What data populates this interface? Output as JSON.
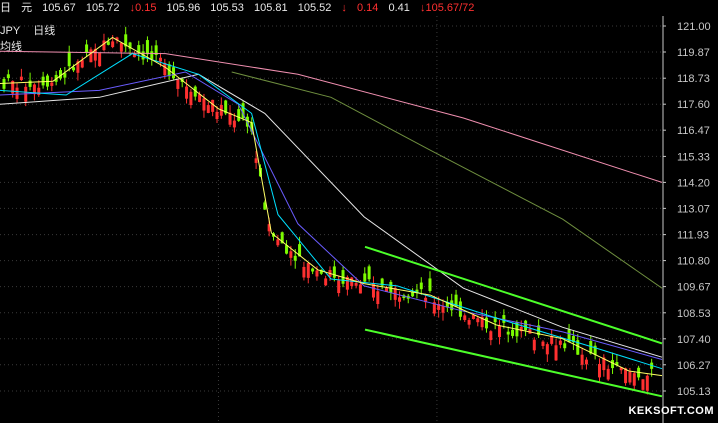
{
  "quote_bar": {
    "label_day": "日",
    "label_yuan": "元",
    "v1": "105.67",
    "v2": "105.72",
    "change": "↓0.15",
    "v3": "105.96",
    "v4": "105.53",
    "v5": "105.81",
    "v6": "105.52",
    "arrow": "↓",
    "change2": "0.14",
    "v7": "0.41",
    "bid_ask": "↓105.67/72"
  },
  "symbol": {
    "code": "JPY",
    "period": "日线",
    "indicator": "均线"
  },
  "watermark": "KEKSOFT.COM",
  "colors": {
    "background": "#000000",
    "up_candle": "#7cfc00",
    "down_candle": "#ff3030",
    "channel": "#4cff2a",
    "ma_fast": "#ffff66",
    "ma_mid": "#00e0ff",
    "ma_purple": "#6a5cff",
    "ma_white": "#e6e6e6",
    "ma_olive": "#6f8f3f",
    "ma_pink": "#f08fb0",
    "axis": "#c8c8c8"
  },
  "chart_data": {
    "type": "candlestick",
    "y_ticks": [
      "121.00",
      "119.87",
      "118.73",
      "117.60",
      "116.47",
      "115.33",
      "114.20",
      "113.07",
      "111.93",
      "110.80",
      "109.67",
      "108.53",
      "107.40",
      "106.27",
      "105.13"
    ],
    "ylim": [
      105.13,
      121.0
    ],
    "grid": true,
    "channel_upper": [
      [
        0.0,
        111.4
      ],
      [
        1.0,
        107.2
      ]
    ],
    "channel_lower": [
      [
        0.0,
        107.8
      ],
      [
        1.0,
        104.9
      ]
    ],
    "moving_averages": [
      {
        "key": "ma_pink",
        "points": [
          [
            0,
            119.9
          ],
          [
            0.25,
            119.8
          ],
          [
            0.45,
            118.9
          ],
          [
            0.7,
            117.0
          ],
          [
            1.0,
            114.2
          ]
        ]
      },
      {
        "key": "ma_olive",
        "points": [
          [
            0.35,
            119.0
          ],
          [
            0.5,
            117.9
          ],
          [
            0.65,
            115.6
          ],
          [
            0.85,
            112.6
          ],
          [
            1.0,
            109.6
          ]
        ]
      },
      {
        "key": "ma_white",
        "points": [
          [
            0.0,
            117.6
          ],
          [
            0.15,
            117.9
          ],
          [
            0.3,
            118.9
          ],
          [
            0.4,
            117.2
          ],
          [
            0.55,
            112.7
          ],
          [
            0.7,
            109.6
          ],
          [
            0.85,
            107.9
          ],
          [
            1.0,
            106.6
          ]
        ]
      },
      {
        "key": "ma_purple",
        "points": [
          [
            0.0,
            118.0
          ],
          [
            0.15,
            118.2
          ],
          [
            0.28,
            119.0
          ],
          [
            0.36,
            117.6
          ],
          [
            0.45,
            112.4
          ],
          [
            0.55,
            109.7
          ],
          [
            0.7,
            108.6
          ],
          [
            0.85,
            107.7
          ],
          [
            1.0,
            106.5
          ]
        ]
      },
      {
        "key": "ma_mid",
        "points": [
          [
            0.0,
            118.2
          ],
          [
            0.1,
            118.0
          ],
          [
            0.2,
            119.8
          ],
          [
            0.3,
            118.9
          ],
          [
            0.38,
            117.2
          ],
          [
            0.42,
            112.8
          ],
          [
            0.5,
            110.0
          ],
          [
            0.6,
            109.7
          ],
          [
            0.75,
            108.3
          ],
          [
            0.9,
            107.0
          ],
          [
            1.0,
            106.1
          ]
        ]
      },
      {
        "key": "ma_fast",
        "points": [
          [
            0.0,
            118.5
          ],
          [
            0.08,
            118.6
          ],
          [
            0.17,
            120.5
          ],
          [
            0.25,
            119.2
          ],
          [
            0.33,
            117.4
          ],
          [
            0.38,
            116.8
          ],
          [
            0.41,
            112.0
          ],
          [
            0.48,
            110.4
          ],
          [
            0.55,
            109.8
          ],
          [
            0.65,
            109.3
          ],
          [
            0.75,
            108.0
          ],
          [
            0.85,
            107.4
          ],
          [
            0.95,
            106.0
          ],
          [
            1.0,
            105.8
          ]
        ]
      }
    ]
  }
}
